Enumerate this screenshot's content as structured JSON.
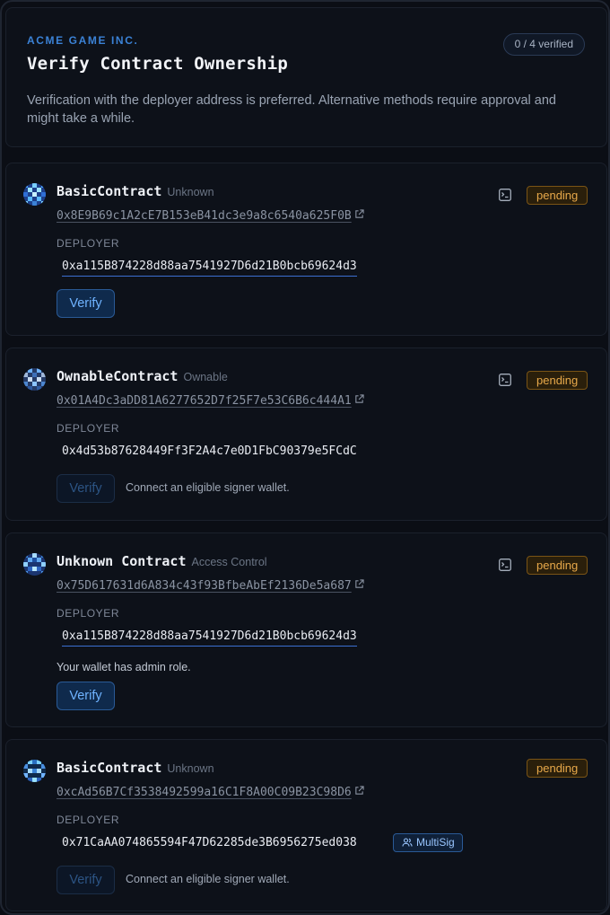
{
  "header": {
    "company": "ACME GAME INC.",
    "title": "Verify Contract Ownership",
    "verified_badge": "0 / 4 verified",
    "description": "Verification with the deployer address is preferred. Alternative methods require approval and might take a while."
  },
  "labels": {
    "deployer": "DEPLOYER",
    "verify": "Verify",
    "connect_hint": "Connect an eligible signer wallet.",
    "admin_note": "Your wallet has admin role."
  },
  "contracts": [
    {
      "name": "BasicContract",
      "type": "Unknown",
      "address": "0x8E9B69c1A2cE7B153eB41dc3e9a8c6540a625F0B",
      "deployer": "0xa115B874228d88aa7541927D6d21B0bcb69624d3",
      "status": "pending",
      "verify_enabled": true
    },
    {
      "name": "OwnableContract",
      "type": "Ownable",
      "address": "0x01A4Dc3aDD81A6277652D7f25F7e53C6B6c444A1",
      "deployer": "0x4d53b87628449Ff3F2A4c7e0D1FbC90379e5FCdC",
      "status": "pending",
      "verify_enabled": false
    },
    {
      "name": "Unknown Contract",
      "type": "Access Control",
      "address": "0x75D617631d6A834c43f93BfbeAbEf2136De5a687",
      "deployer": "0xa115B874228d88aa7541927D6d21B0bcb69624d3",
      "status": "pending",
      "verify_enabled": true
    },
    {
      "name": "BasicContract",
      "type": "Unknown",
      "address": "0xcAd56B7Cf3538492599a16C1F8A00C09B23C98D6",
      "deployer": "0x71CaAA074865594F47D62285de3B6956275ed038",
      "deployer_badge": "MultiSig",
      "status": "pending",
      "verify_enabled": false
    }
  ],
  "colors": {
    "accent": "#3b82d6",
    "pending_text": "#e8a94a",
    "pending_bg": "#2a1f0b",
    "background": "#0a0d14"
  }
}
